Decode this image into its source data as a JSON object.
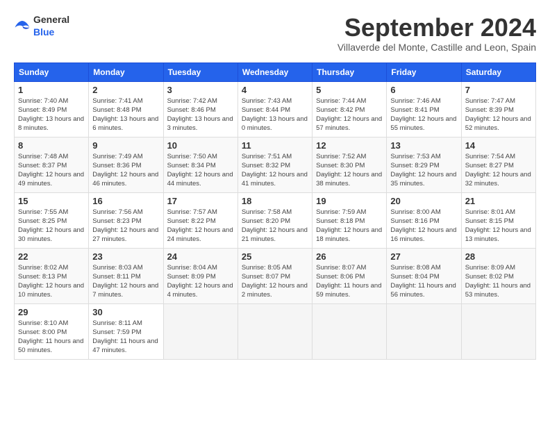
{
  "header": {
    "logo_general": "General",
    "logo_blue": "Blue",
    "month_title": "September 2024",
    "subtitle": "Villaverde del Monte, Castille and Leon, Spain"
  },
  "weekdays": [
    "Sunday",
    "Monday",
    "Tuesday",
    "Wednesday",
    "Thursday",
    "Friday",
    "Saturday"
  ],
  "weeks": [
    [
      {
        "day": "1",
        "sunrise": "7:40 AM",
        "sunset": "8:49 PM",
        "daylight": "13 hours and 8 minutes."
      },
      {
        "day": "2",
        "sunrise": "7:41 AM",
        "sunset": "8:48 PM",
        "daylight": "13 hours and 6 minutes."
      },
      {
        "day": "3",
        "sunrise": "7:42 AM",
        "sunset": "8:46 PM",
        "daylight": "13 hours and 3 minutes."
      },
      {
        "day": "4",
        "sunrise": "7:43 AM",
        "sunset": "8:44 PM",
        "daylight": "13 hours and 0 minutes."
      },
      {
        "day": "5",
        "sunrise": "7:44 AM",
        "sunset": "8:42 PM",
        "daylight": "12 hours and 57 minutes."
      },
      {
        "day": "6",
        "sunrise": "7:46 AM",
        "sunset": "8:41 PM",
        "daylight": "12 hours and 55 minutes."
      },
      {
        "day": "7",
        "sunrise": "7:47 AM",
        "sunset": "8:39 PM",
        "daylight": "12 hours and 52 minutes."
      }
    ],
    [
      {
        "day": "8",
        "sunrise": "7:48 AM",
        "sunset": "8:37 PM",
        "daylight": "12 hours and 49 minutes."
      },
      {
        "day": "9",
        "sunrise": "7:49 AM",
        "sunset": "8:36 PM",
        "daylight": "12 hours and 46 minutes."
      },
      {
        "day": "10",
        "sunrise": "7:50 AM",
        "sunset": "8:34 PM",
        "daylight": "12 hours and 44 minutes."
      },
      {
        "day": "11",
        "sunrise": "7:51 AM",
        "sunset": "8:32 PM",
        "daylight": "12 hours and 41 minutes."
      },
      {
        "day": "12",
        "sunrise": "7:52 AM",
        "sunset": "8:30 PM",
        "daylight": "12 hours and 38 minutes."
      },
      {
        "day": "13",
        "sunrise": "7:53 AM",
        "sunset": "8:29 PM",
        "daylight": "12 hours and 35 minutes."
      },
      {
        "day": "14",
        "sunrise": "7:54 AM",
        "sunset": "8:27 PM",
        "daylight": "12 hours and 32 minutes."
      }
    ],
    [
      {
        "day": "15",
        "sunrise": "7:55 AM",
        "sunset": "8:25 PM",
        "daylight": "12 hours and 30 minutes."
      },
      {
        "day": "16",
        "sunrise": "7:56 AM",
        "sunset": "8:23 PM",
        "daylight": "12 hours and 27 minutes."
      },
      {
        "day": "17",
        "sunrise": "7:57 AM",
        "sunset": "8:22 PM",
        "daylight": "12 hours and 24 minutes."
      },
      {
        "day": "18",
        "sunrise": "7:58 AM",
        "sunset": "8:20 PM",
        "daylight": "12 hours and 21 minutes."
      },
      {
        "day": "19",
        "sunrise": "7:59 AM",
        "sunset": "8:18 PM",
        "daylight": "12 hours and 18 minutes."
      },
      {
        "day": "20",
        "sunrise": "8:00 AM",
        "sunset": "8:16 PM",
        "daylight": "12 hours and 16 minutes."
      },
      {
        "day": "21",
        "sunrise": "8:01 AM",
        "sunset": "8:15 PM",
        "daylight": "12 hours and 13 minutes."
      }
    ],
    [
      {
        "day": "22",
        "sunrise": "8:02 AM",
        "sunset": "8:13 PM",
        "daylight": "12 hours and 10 minutes."
      },
      {
        "day": "23",
        "sunrise": "8:03 AM",
        "sunset": "8:11 PM",
        "daylight": "12 hours and 7 minutes."
      },
      {
        "day": "24",
        "sunrise": "8:04 AM",
        "sunset": "8:09 PM",
        "daylight": "12 hours and 4 minutes."
      },
      {
        "day": "25",
        "sunrise": "8:05 AM",
        "sunset": "8:07 PM",
        "daylight": "12 hours and 2 minutes."
      },
      {
        "day": "26",
        "sunrise": "8:07 AM",
        "sunset": "8:06 PM",
        "daylight": "11 hours and 59 minutes."
      },
      {
        "day": "27",
        "sunrise": "8:08 AM",
        "sunset": "8:04 PM",
        "daylight": "11 hours and 56 minutes."
      },
      {
        "day": "28",
        "sunrise": "8:09 AM",
        "sunset": "8:02 PM",
        "daylight": "11 hours and 53 minutes."
      }
    ],
    [
      {
        "day": "29",
        "sunrise": "8:10 AM",
        "sunset": "8:00 PM",
        "daylight": "11 hours and 50 minutes."
      },
      {
        "day": "30",
        "sunrise": "8:11 AM",
        "sunset": "7:59 PM",
        "daylight": "11 hours and 47 minutes."
      },
      null,
      null,
      null,
      null,
      null
    ]
  ],
  "labels": {
    "sunrise": "Sunrise:",
    "sunset": "Sunset:",
    "daylight": "Daylight:"
  }
}
